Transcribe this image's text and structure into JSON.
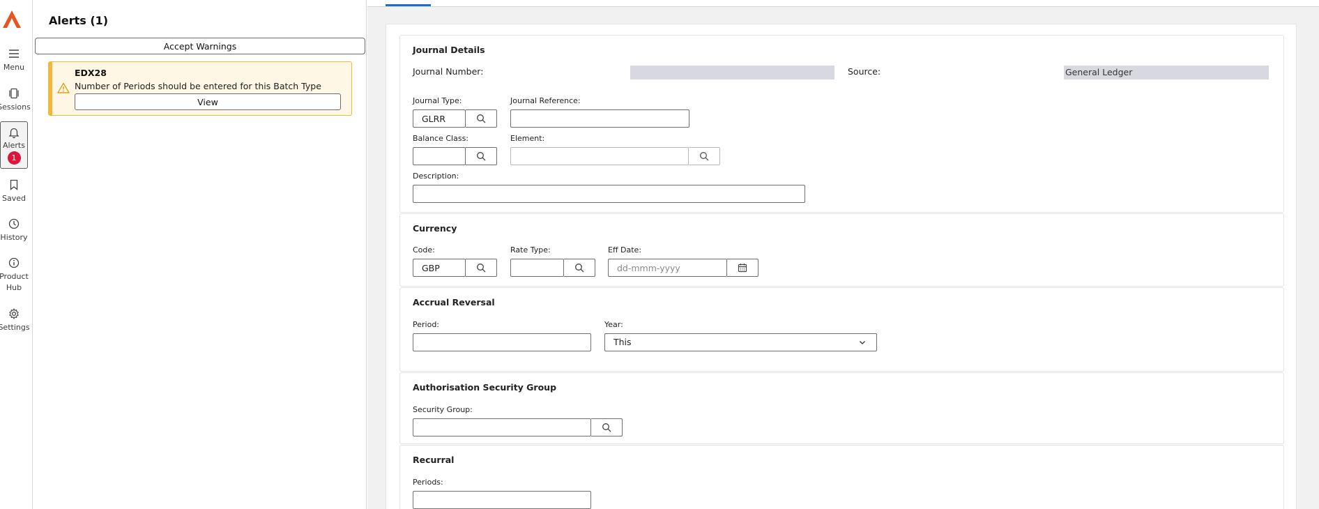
{
  "nav": {
    "items": [
      {
        "id": "menu",
        "label": "Menu",
        "icon": "menu-icon"
      },
      {
        "id": "sessions",
        "label": "Sessions",
        "icon": "sessions-icon"
      },
      {
        "id": "alerts",
        "label": "Alerts",
        "icon": "bell-icon",
        "badge": "1",
        "active": true
      },
      {
        "id": "saved",
        "label": "Saved",
        "icon": "bookmark-icon"
      },
      {
        "id": "history",
        "label": "History",
        "icon": "clock-icon"
      },
      {
        "id": "product-hub",
        "label": "Product Hub",
        "label_line1": "Product",
        "label_line2": "Hub",
        "icon": "info-icon"
      },
      {
        "id": "settings",
        "label": "Settings",
        "icon": "gear-icon"
      }
    ]
  },
  "alerts_panel": {
    "title": "Alerts (1)",
    "accept_label": "Accept Warnings",
    "alerts": [
      {
        "code": "EDX28",
        "message": "Number of Periods should be entered for this Batch Type",
        "view_label": "View",
        "icon": "warning-icon"
      }
    ]
  },
  "journal_details": {
    "title": "Journal Details",
    "journal_number_label": "Journal Number:",
    "journal_number_value": "",
    "source_label": "Source:",
    "source_value": "General Ledger",
    "journal_type_label": "Journal Type:",
    "journal_type_value": "GLRR",
    "journal_reference_label": "Journal Reference:",
    "journal_reference_value": "",
    "balance_class_label": "Balance Class:",
    "balance_class_value": "",
    "element_label": "Element:",
    "element_value": "",
    "description_label": "Description:",
    "description_value": ""
  },
  "currency": {
    "title": "Currency",
    "code_label": "Code:",
    "code_value": "GBP",
    "rate_type_label": "Rate Type:",
    "rate_type_value": "",
    "eff_date_label": "Eff Date:",
    "eff_date_placeholder": "dd-mmm-yyyy"
  },
  "accrual_reversal": {
    "title": "Accrual Reversal",
    "period_label": "Period:",
    "period_value": "",
    "year_label": "Year:",
    "year_value": "This"
  },
  "authorisation": {
    "title": "Authorisation Security Group",
    "security_group_label": "Security Group:",
    "security_group_value": ""
  },
  "recurral": {
    "title": "Recurral",
    "periods_label": "Periods:",
    "periods_value": ""
  },
  "colors": {
    "accent": "#1f6fc9",
    "warning_border": "#f3b73a",
    "warning_bg": "#fff7e5",
    "badge": "#e0133b",
    "logo": "#e8531f"
  }
}
